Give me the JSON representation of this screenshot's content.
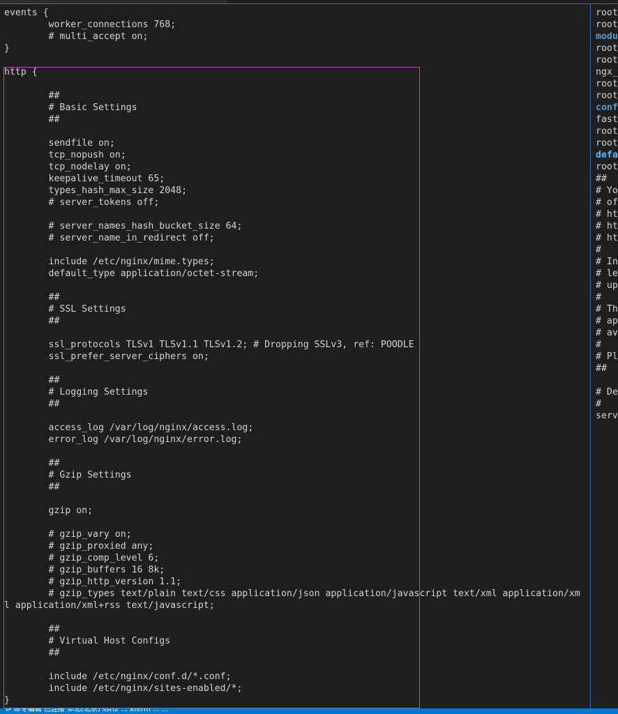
{
  "editor": {
    "left_lines": [
      "events {",
      "        worker_connections 768;",
      "        # multi_accept on;",
      "}",
      "",
      "http {",
      "",
      "        ##",
      "        # Basic Settings",
      "        ##",
      "",
      "        sendfile on;",
      "        tcp_nopush on;",
      "        tcp_nodelay on;",
      "        keepalive_timeout 65;",
      "        types_hash_max_size 2048;",
      "        # server_tokens off;",
      "",
      "        # server_names_hash_bucket_size 64;",
      "        # server_name_in_redirect off;",
      "",
      "        include /etc/nginx/mime.types;",
      "        default_type application/octet-stream;",
      "",
      "        ##",
      "        # SSL Settings",
      "        ##",
      "",
      "        ssl_protocols TLSv1 TLSv1.1 TLSv1.2; # Dropping SSLv3, ref: POODLE",
      "        ssl_prefer_server_ciphers on;",
      "",
      "        ##",
      "        # Logging Settings",
      "        ##",
      "",
      "        access_log /var/log/nginx/access.log;",
      "        error_log /var/log/nginx/error.log;",
      "",
      "        ##",
      "        # Gzip Settings",
      "        ##",
      "",
      "        gzip on;",
      "",
      "        # gzip_vary on;",
      "        # gzip_proxied any;",
      "        # gzip_comp_level 6;",
      "        # gzip_buffers 16 8k;",
      "        # gzip_http_version 1.1;",
      "        # gzip_types text/plain text/css application/json application/javascript text/xml application/xm",
      "l application/xml+rss text/javascript;",
      "",
      "        ##",
      "        # Virtual Host Configs",
      "        ##",
      "",
      "        include /etc/nginx/conf.d/*.conf;",
      "        include /etc/nginx/sites-enabled/*;",
      "}"
    ],
    "right_lines": [
      {
        "text": "root",
        "style": "normal"
      },
      {
        "text": "root",
        "style": "normal"
      },
      {
        "text": "modu",
        "style": "blue"
      },
      {
        "text": "root",
        "style": "normal"
      },
      {
        "text": "root",
        "style": "normal"
      },
      {
        "text": "ngx_",
        "style": "normal"
      },
      {
        "text": "root",
        "style": "normal"
      },
      {
        "text": "root",
        "style": "normal"
      },
      {
        "text": "conf",
        "style": "blue"
      },
      {
        "text": "fast",
        "style": "normal"
      },
      {
        "text": "root",
        "style": "normal"
      },
      {
        "text": "root",
        "style": "normal"
      },
      {
        "text": "defa",
        "style": "cyan"
      },
      {
        "text": "root",
        "style": "normal"
      },
      {
        "text": "##",
        "style": "normal"
      },
      {
        "text": "# Yo",
        "style": "normal"
      },
      {
        "text": "# of",
        "style": "normal"
      },
      {
        "text": "# ht",
        "style": "normal"
      },
      {
        "text": "# ht",
        "style": "normal"
      },
      {
        "text": "# ht",
        "style": "normal"
      },
      {
        "text": "#",
        "style": "normal"
      },
      {
        "text": "# In",
        "style": "normal"
      },
      {
        "text": "# le",
        "style": "normal"
      },
      {
        "text": "# up",
        "style": "normal"
      },
      {
        "text": "#",
        "style": "normal"
      },
      {
        "text": "# Th",
        "style": "normal"
      },
      {
        "text": "# ap",
        "style": "normal"
      },
      {
        "text": "# av",
        "style": "normal"
      },
      {
        "text": "#",
        "style": "normal"
      },
      {
        "text": "# Pl",
        "style": "normal"
      },
      {
        "text": "##",
        "style": "normal"
      },
      {
        "text": "",
        "style": "normal"
      },
      {
        "text": "# De",
        "style": "normal"
      },
      {
        "text": "#",
        "style": "normal"
      },
      {
        "text": "serv",
        "style": "normal"
      }
    ]
  },
  "statusbar": {
    "text": "  ⊳   命令编辑   已连接   华北(北京)   ssh2   ...   xterm   ...   ..."
  },
  "colors": {
    "background": "#1e1e1e",
    "text": "#d4d4d4",
    "highlight_border": "#c041c0",
    "pane_divider": "#2d6bd0",
    "statusbar": "#007acc"
  }
}
